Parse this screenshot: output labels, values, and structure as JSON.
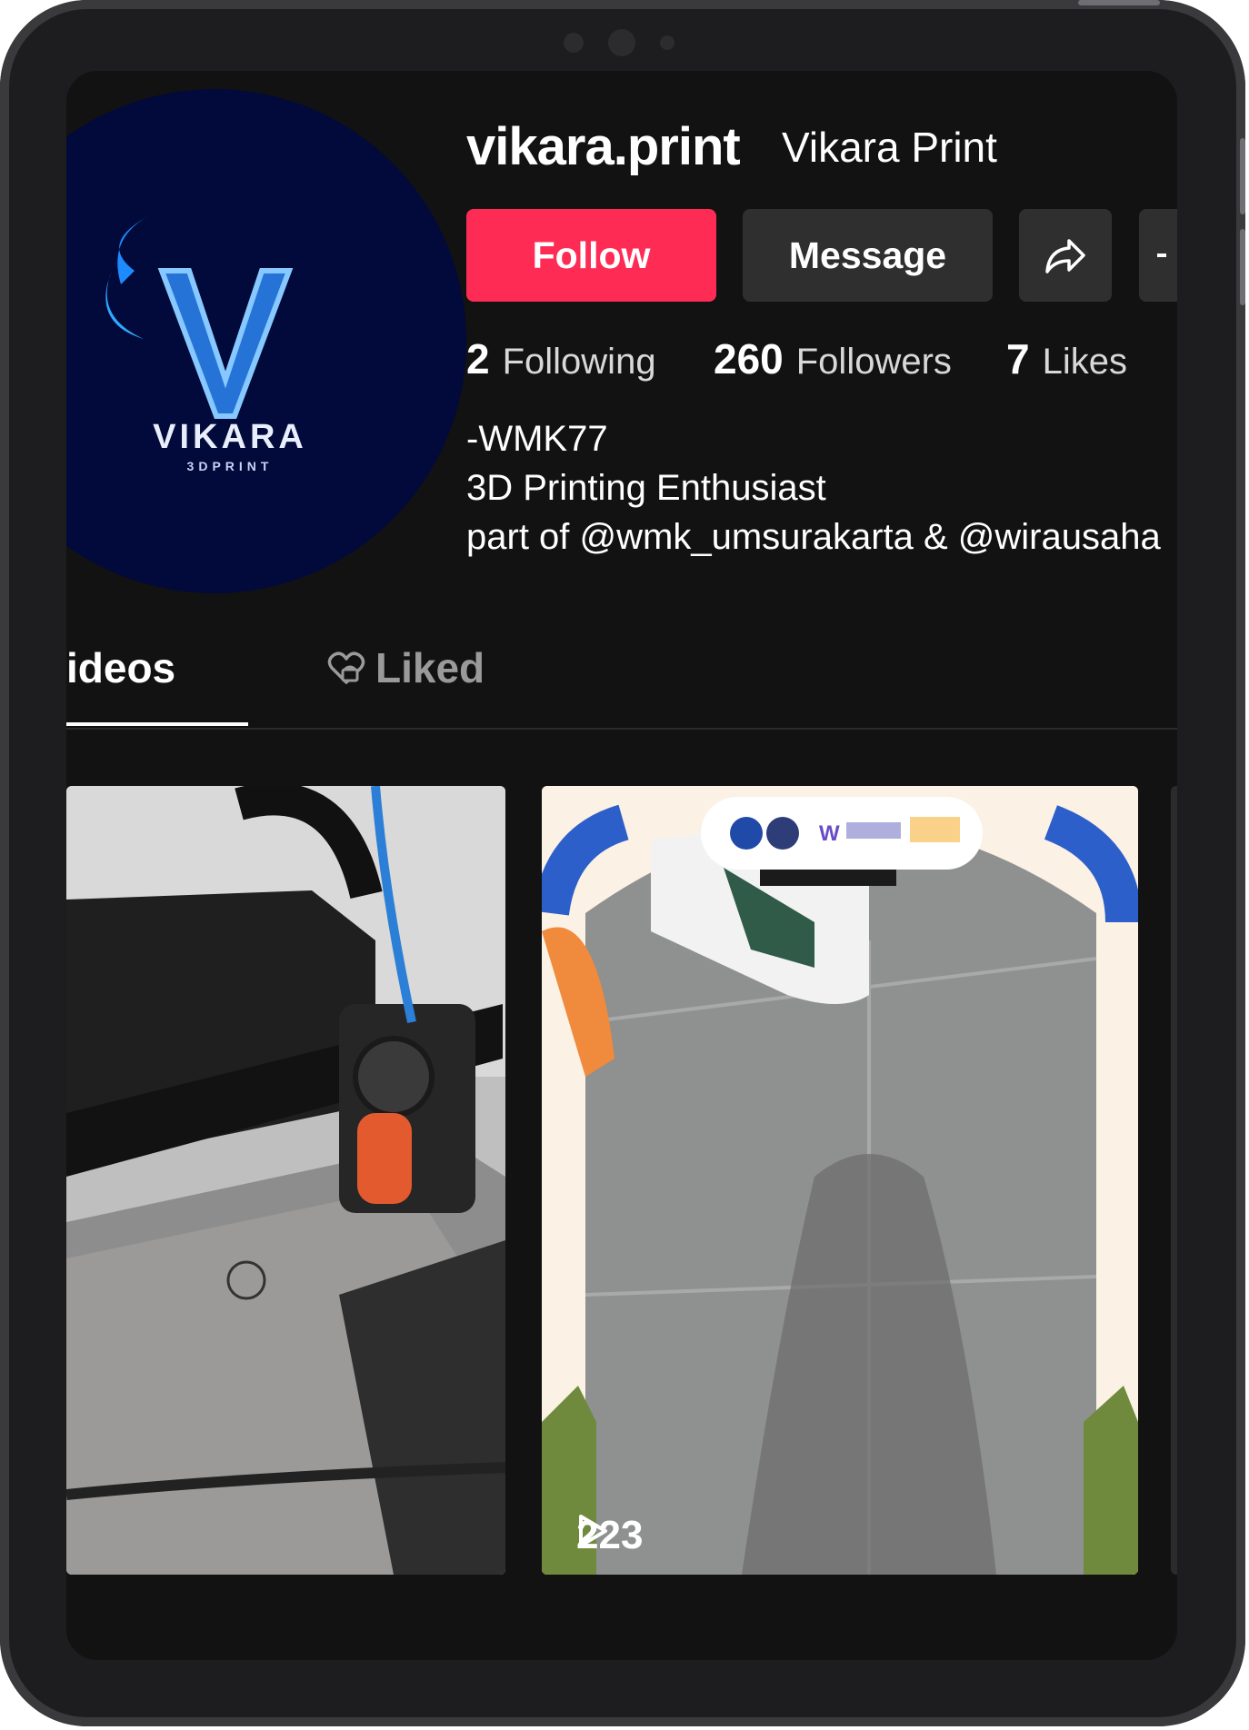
{
  "profile": {
    "username": "vikara.print",
    "display_name": "Vikara Print",
    "avatar_text": "VIKARA",
    "avatar_subtext": "3DPRINT"
  },
  "actions": {
    "follow_label": "Follow",
    "message_label": "Message",
    "share_icon": "share-icon",
    "more_icon": "more-icon"
  },
  "stats": {
    "following_count": "2",
    "following_label": "Following",
    "followers_count": "260",
    "followers_label": "Followers",
    "likes_count": "7",
    "likes_label": "Likes"
  },
  "bio": {
    "line1": "-WMK77",
    "line2": "3D Printing Enthusiast",
    "line3": "part of @wmk_umsurakarta & @wirausaha"
  },
  "tabs": {
    "videos_label": "ideos",
    "liked_label": "Liked"
  },
  "videos": [
    {
      "thumbnail": "3d-printer-print-bed"
    },
    {
      "thumbnail": "sneaker-on-pavement-frame",
      "views": "223"
    }
  ],
  "colors": {
    "follow_red": "#fe2c55",
    "background": "#121212",
    "button_gray": "#2f2f2f"
  }
}
